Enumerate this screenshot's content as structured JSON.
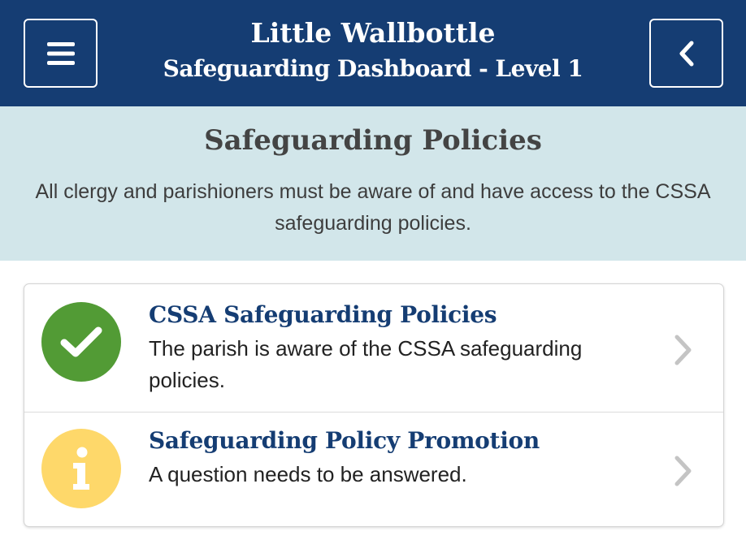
{
  "header": {
    "title": "Little Wallbottle",
    "subtitle": "Safeguarding Dashboard - Level 1",
    "menu_icon": "hamburger-menu-icon",
    "back_icon": "chevron-left-icon"
  },
  "intro": {
    "title": "Safeguarding Policies",
    "text": "All clergy and parishioners must be aware of and have access to the CSSA safeguarding policies."
  },
  "items": [
    {
      "title": "CSSA Safeguarding Policies",
      "description": "The parish is aware of the CSSA safeguarding policies.",
      "status": "complete",
      "status_icon": "checkmark-icon",
      "status_color": "#529b35"
    },
    {
      "title": "Safeguarding Policy Promotion",
      "description": "A question needs to be answered.",
      "status": "info",
      "status_icon": "info-icon",
      "status_color": "#fed86a"
    }
  ],
  "colors": {
    "header_bg": "#153d73",
    "intro_bg": "#d2e6ea",
    "title_text": "#153d73",
    "chevron": "#c4c4c4"
  }
}
